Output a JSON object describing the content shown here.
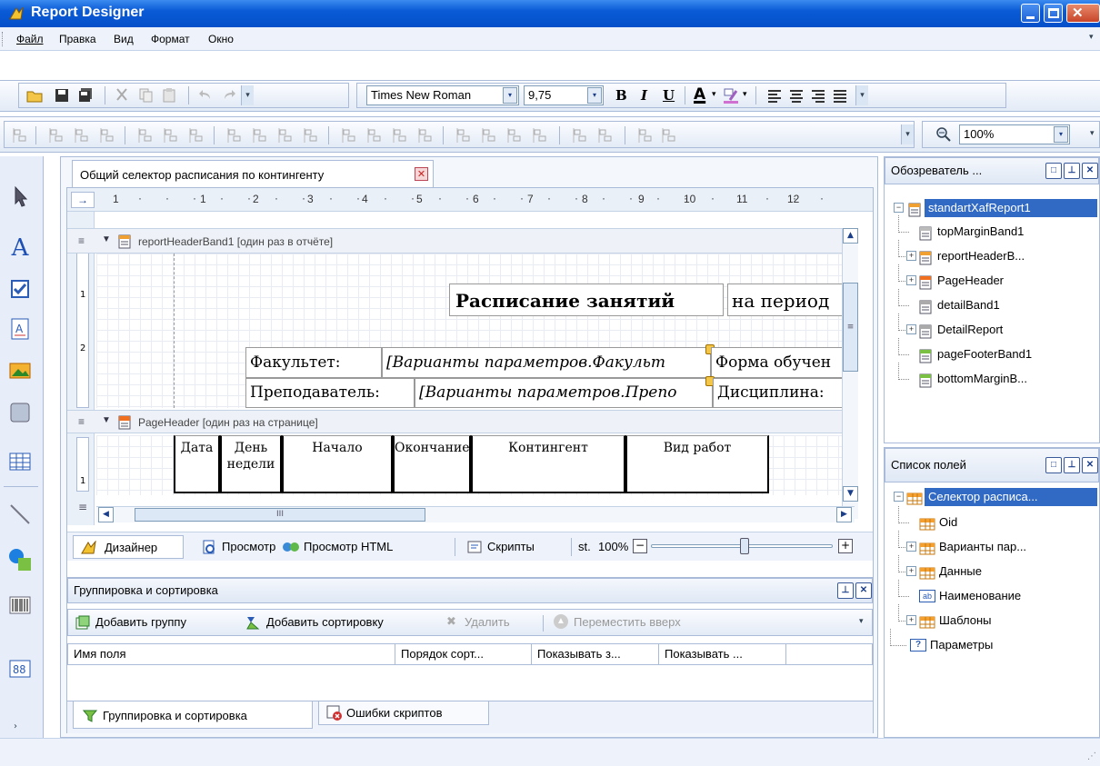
{
  "window": {
    "title": "Report Designer"
  },
  "menu": [
    "Файл",
    "Правка",
    "Вид",
    "Формат",
    "Окно"
  ],
  "toolbar": {
    "font_name": "Times New Roman",
    "font_size": "9,75",
    "bold": "B",
    "italic": "I",
    "underline": "U",
    "fore_color": "A",
    "zoom": "100%"
  },
  "document": {
    "tab_title": "Общий селектор расписания по контингенту",
    "ruler_marks": [
      "1",
      "1",
      "2",
      "3",
      "4",
      "5",
      "6",
      "7",
      "8",
      "9",
      "10",
      "11",
      "12"
    ],
    "side_ruler": [
      "1",
      "2",
      "1"
    ],
    "bands": {
      "report_header": "reportHeaderBand1 [один раз в отчёте]",
      "page_header": "PageHeader [один раз на странице]"
    },
    "cells": {
      "title": "Расписание занятий",
      "period": "на период",
      "faculty_label": "Факультет:",
      "faculty_value": "[Варианты параметров.Факульт",
      "form_label": "Форма обучен",
      "teacher_label": "Преподаватель:",
      "teacher_value": "[Варианты параметров.Препо",
      "discipline_label": "Дисциплина:"
    },
    "columns": [
      "Дата",
      "День недели",
      "Начало",
      "Окончание",
      "Контингент",
      "Вид работ"
    ],
    "scroll_mark": "III",
    "view_tabs": {
      "designer": "Дизайнер",
      "preview": "Просмотр",
      "html_preview": "Просмотр HTML",
      "scripts": "Скрипты",
      "st": "st.",
      "zoom": "100%"
    }
  },
  "grouping": {
    "title": "Группировка и сортировка",
    "add_group": "Добавить группу",
    "add_sort": "Добавить сортировку",
    "delete": "Удалить",
    "move_up": "Переместить вверх",
    "columns": [
      "Имя поля",
      "Порядок сорт...",
      "Показывать з...",
      "Показывать ..."
    ],
    "tabs": {
      "grouping": "Группировка и сортировка",
      "errors": "Ошибки скриптов"
    }
  },
  "explorer": {
    "title": "Обозреватель ...",
    "root": "standartXafReport1",
    "items": [
      "topMarginBand1",
      "reportHeaderB...",
      "PageHeader",
      "detailBand1",
      "DetailReport",
      "pageFooterBand1",
      "bottomMarginB..."
    ]
  },
  "fields": {
    "title": "Список полей",
    "root": "Селектор расписа...",
    "items": [
      "Oid",
      "Варианты пар...",
      "Данные",
      "Наименование",
      "Шаблоны",
      "Параметры"
    ]
  },
  "colors": {
    "title_bar": "#0a5ad6",
    "accent": "#316ac5",
    "selection": "#316ac5"
  }
}
